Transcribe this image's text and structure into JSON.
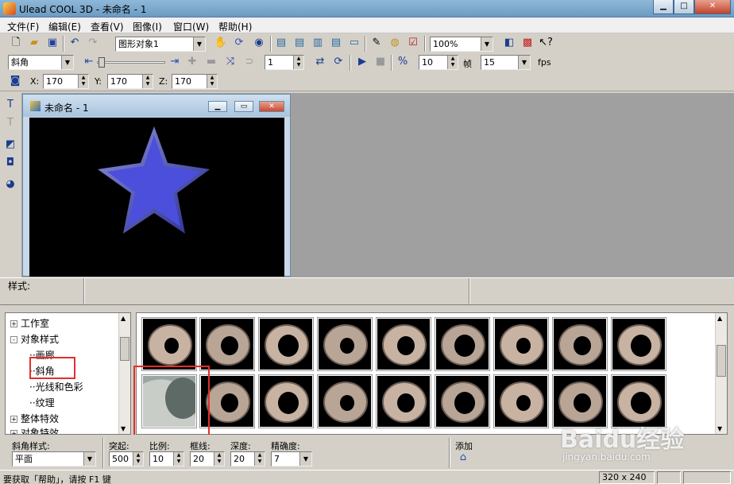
{
  "window": {
    "title": "Ulead COOL 3D - 未命名 - 1"
  },
  "menu": [
    "文件(F)",
    "编辑(E)",
    "查看(V)",
    "图像(I)",
    "窗口(W)",
    "帮助(H)"
  ],
  "toolbar1": {
    "object_combo": "图形对象1",
    "zoom_combo": "100%"
  },
  "toolbar2": {
    "effect_combo": "斜角",
    "frame_value": "1",
    "frames_value": "10",
    "frames_label": "帧",
    "fps_value": "15",
    "fps_label": "fps"
  },
  "toolbar3": {
    "x_label": "X:",
    "x_value": "170",
    "y_label": "Y:",
    "y_value": "170",
    "z_label": "Z:",
    "z_value": "170"
  },
  "document": {
    "title": "未命名 - 1",
    "star_color": "#4b4fdc"
  },
  "style_panel": {
    "label": "样式:"
  },
  "tree": {
    "items": [
      {
        "label": "工作室",
        "expander": "+"
      },
      {
        "label": "对象样式",
        "expander": "-"
      },
      {
        "label": "画廊"
      },
      {
        "label": "斜角"
      },
      {
        "label": "光线和色彩"
      },
      {
        "label": "纹理"
      },
      {
        "label": "整体特效",
        "expander": "+"
      },
      {
        "label": "对象特效",
        "expander": "+"
      }
    ]
  },
  "props": {
    "bevel_style_label": "斜角样式:",
    "bevel_style_value": "平面",
    "protrude_label": "突起:",
    "protrude_value": "500",
    "ratio_label": "比例:",
    "ratio_value": "10",
    "border_label": "框线:",
    "border_value": "20",
    "depth_label": "深度:",
    "depth_value": "20",
    "precision_label": "精确度:",
    "precision_value": "7",
    "add_label": "添加"
  },
  "statusbar": {
    "hint": "要获取「帮助」，请按 F1 键",
    "size": "320 x 240"
  },
  "watermark": {
    "text": "Baidu经验",
    "sub": "jingyan.baidu.com"
  }
}
